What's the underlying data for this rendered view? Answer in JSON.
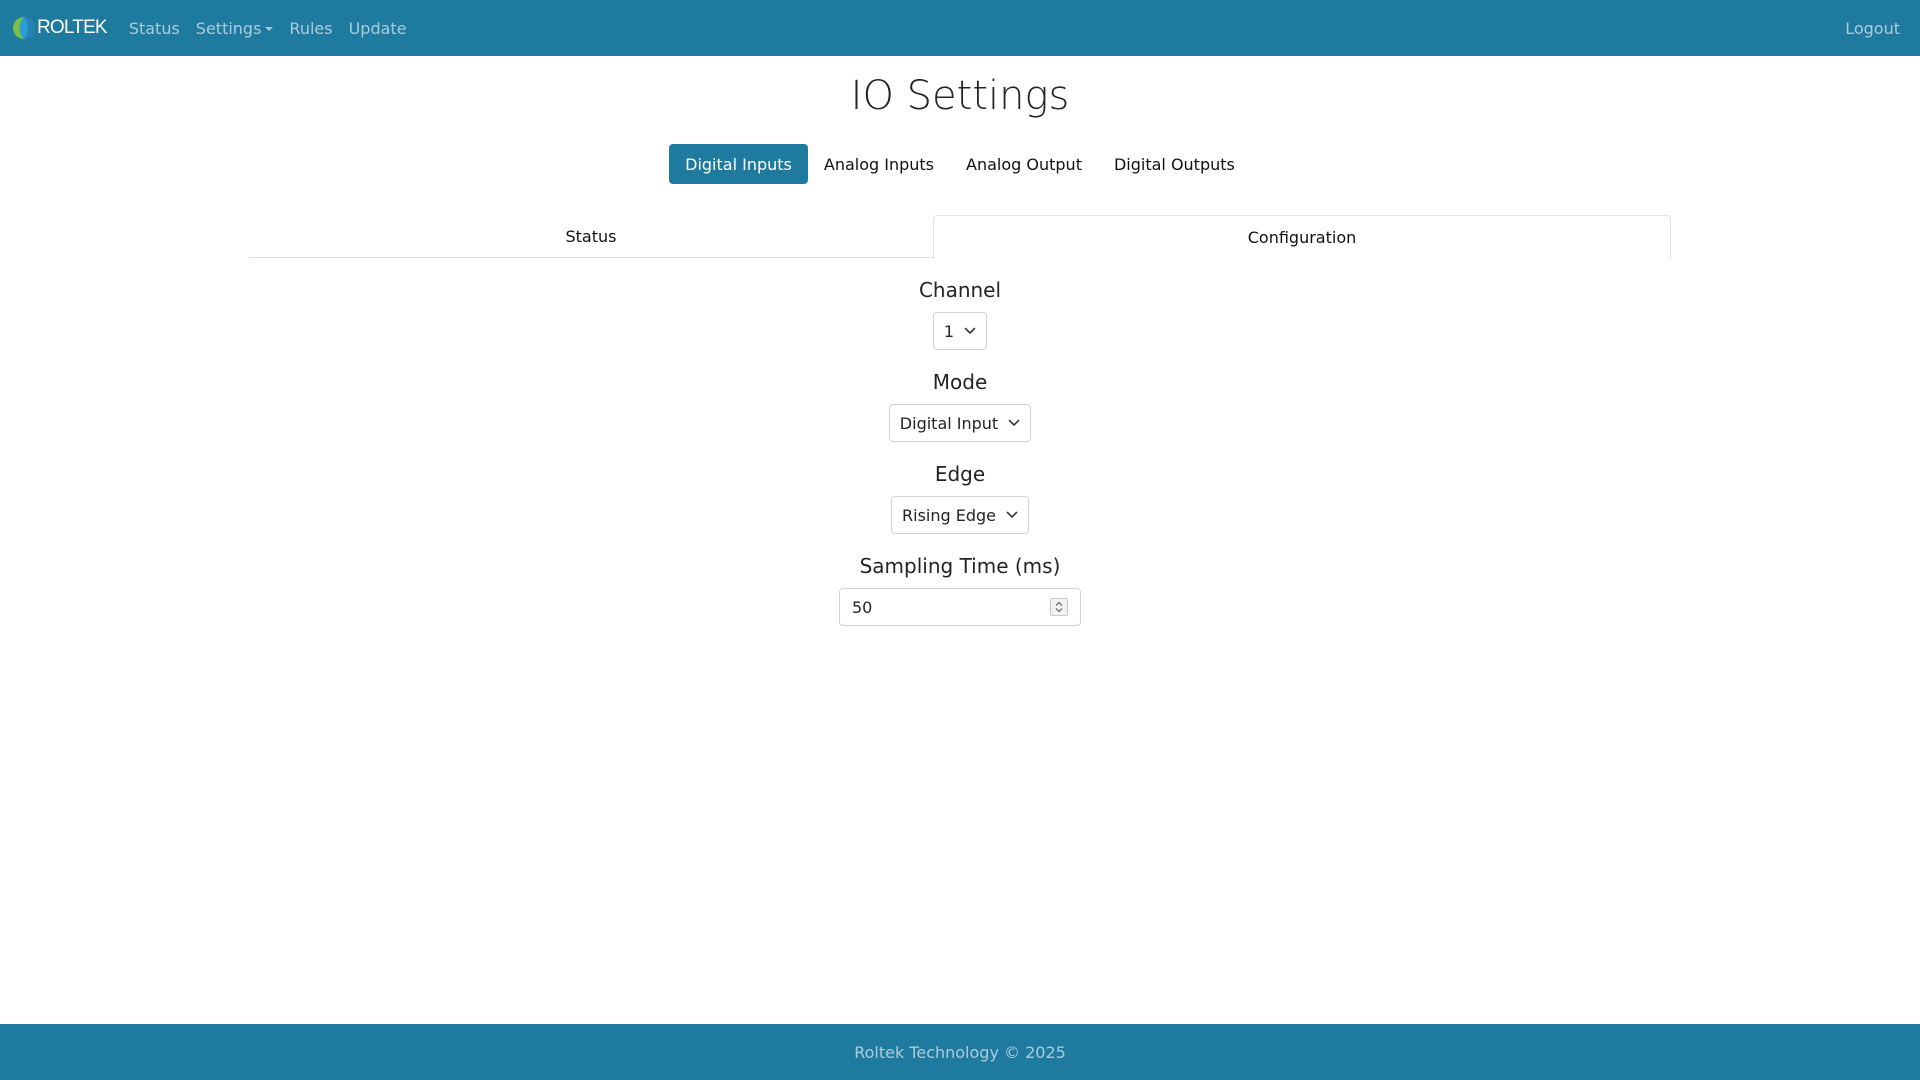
{
  "nav": {
    "brand": "ROLTEK",
    "items": [
      {
        "label": "Status"
      },
      {
        "label": "Settings"
      },
      {
        "label": "Rules"
      },
      {
        "label": "Update"
      }
    ],
    "logout": "Logout"
  },
  "page": {
    "title": "IO Settings"
  },
  "io_tabs": [
    {
      "label": "Digital Inputs",
      "active": true
    },
    {
      "label": "Analog Inputs",
      "active": false
    },
    {
      "label": "Analog Output",
      "active": false
    },
    {
      "label": "Digital Outputs",
      "active": false
    }
  ],
  "sub_tabs": [
    {
      "label": "Status",
      "active": false
    },
    {
      "label": "Configuration",
      "active": true
    }
  ],
  "form": {
    "channel": {
      "label": "Channel",
      "value": "1"
    },
    "mode": {
      "label": "Mode",
      "value": "Digital Input"
    },
    "edge": {
      "label": "Edge",
      "value": "Rising Edge"
    },
    "sampling": {
      "label": "Sampling Time (ms)",
      "value": "50"
    }
  },
  "footer": {
    "text": "Roltek Technology © 2025"
  },
  "colors": {
    "primary": "#1f7aa0",
    "logo_green": "#7cc142",
    "logo_blue": "#2a9fd6"
  }
}
